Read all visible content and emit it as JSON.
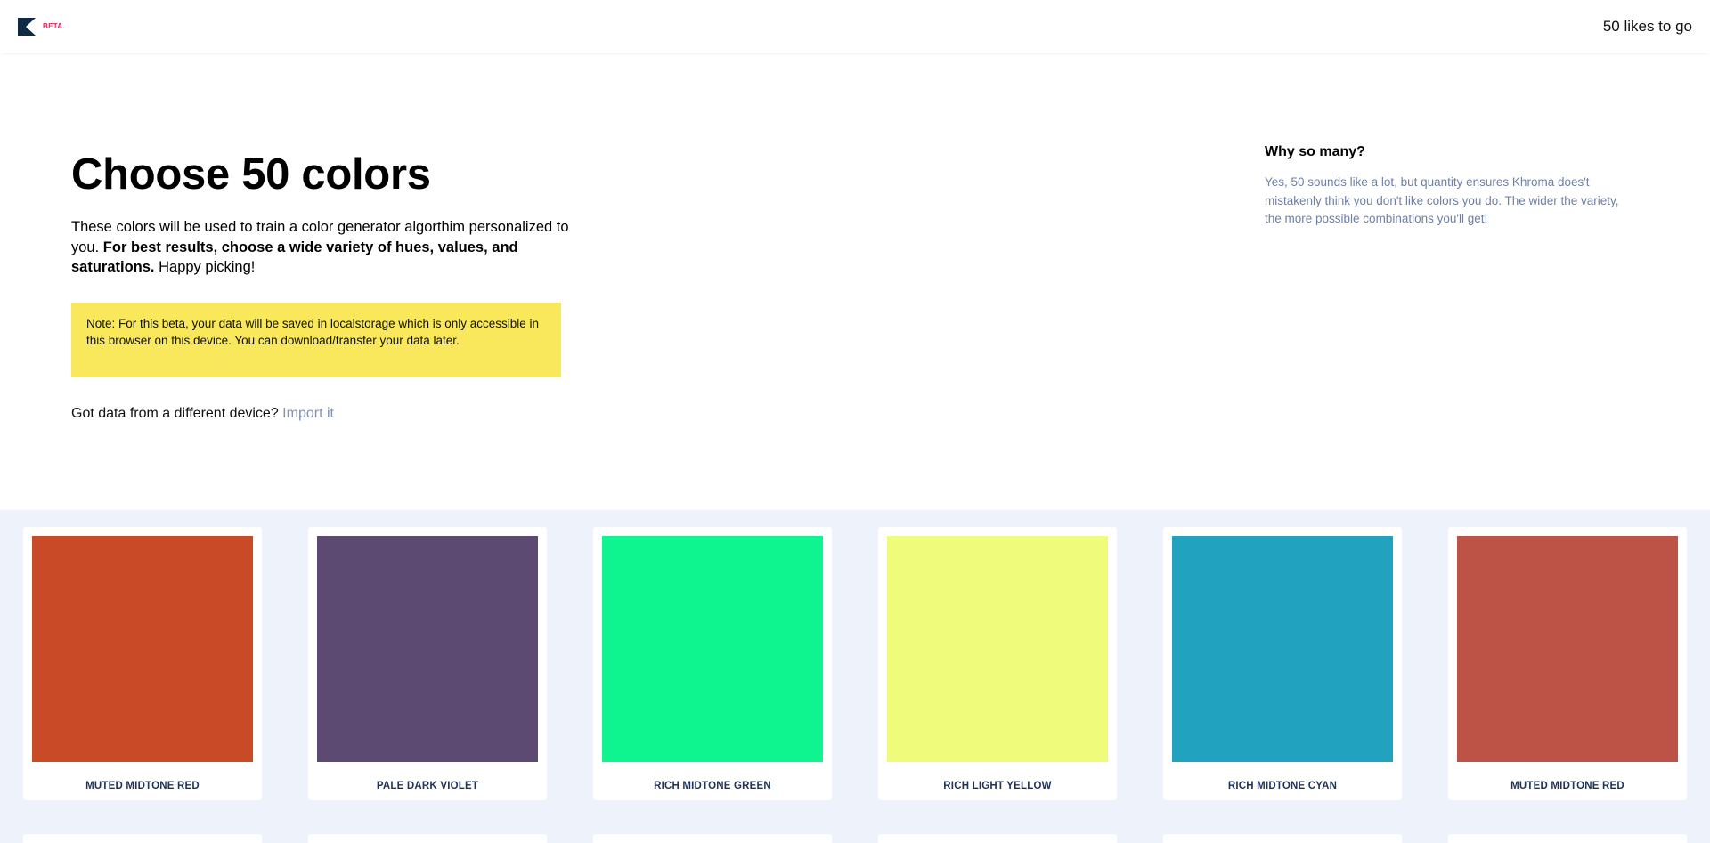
{
  "header": {
    "beta_label": "BETA",
    "likes_text": "50 likes to go"
  },
  "hero": {
    "title": "Choose 50 colors",
    "intro_plain": "These colors will be used to train a color generator algorthim personalized to you. ",
    "intro_bold": "For best results, choose a wide variety of hues, values, and saturations.",
    "intro_tail": " Happy picking!",
    "note": "Note: For this beta, your data will be saved in localstorage which is only accessible in this browser on this device. You can download/transfer your data later.",
    "import_prompt": "Got data from a different device? ",
    "import_link": "Import it"
  },
  "sidebar": {
    "title": "Why so many?",
    "body": "Yes, 50 sounds like a lot, but quantity ensures Khroma does't mistakenly think you don't like colors you do. The wider the variety, the more possible combinations you'll get!"
  },
  "colors": {
    "brand_beta": "#e5245b",
    "note_bg": "#f9e85b",
    "link": "#8192b4",
    "grid_bg": "#eef3fb",
    "label_text": "#1f3358"
  },
  "icons": {
    "logo": "khroma-k-logo"
  },
  "swatches": [
    {
      "label": "MUTED MIDTONE RED",
      "color": "#c94a27"
    },
    {
      "label": "PALE DARK VIOLET",
      "color": "#5d4a73"
    },
    {
      "label": "RICH MIDTONE GREEN",
      "color": "#0ef48f"
    },
    {
      "label": "RICH LIGHT YELLOW",
      "color": "#eefb7b"
    },
    {
      "label": "RICH MIDTONE CYAN",
      "color": "#21a2bf"
    },
    {
      "label": "MUTED MIDTONE RED",
      "color": "#bd5246"
    }
  ]
}
